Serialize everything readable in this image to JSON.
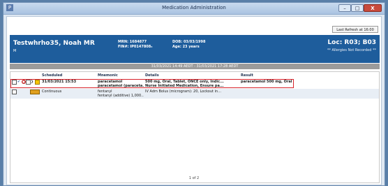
{
  "window": {
    "app_icon": "P",
    "title": "Medication Administration",
    "minimize_label": "–",
    "maximize_label": "□",
    "close_label": "X"
  },
  "toolbar": {
    "refresh_label": "Last Refresh at 16:00 AEST"
  },
  "patient": {
    "name": "Testwhrho35, Noah   MR",
    "sex": "M",
    "mrn": "MRN: 1684877",
    "fin": "FIN#: IP0147808₃",
    "dob": "DOB: 03/03/1998",
    "age": "Age: 23 years",
    "location": "Loc: R03; B03",
    "allergies": "** Allergies Not Recorded **"
  },
  "date_range": "31/03/2021 14:49 AEDT - 31/03/2021 17:28 AEDT",
  "table": {
    "columns": [
      "Scheduled",
      "Mnemonic",
      "Details",
      "Result"
    ],
    "rows": [
      {
        "scheduled": "31/03/2021 15:53",
        "mnemonic_1": "paracetamol",
        "mnemonic_2": "paracetamol (paraceta...",
        "details_1": "500 mg, Oral, Tablet, ONCE only, Indic...",
        "details_2": "Nurse Initiated Medication, Ensure pa...",
        "result": "paracetamol 500 mg, Oral"
      },
      {
        "scheduled": "Continuous",
        "mnemonic_1": "fentanyl",
        "mnemonic_2": "fentanyl (additive) 1,000...",
        "details_1": "IV Adm Bolus (microgram): 20, Lockout in...",
        "details_2": "",
        "result": ""
      }
    ]
  },
  "pager": "1 of 2",
  "icons": {
    "row1": [
      "checkbox-icon",
      "checkmark-icon",
      "stop-icon",
      "note-icon",
      "tag-icon",
      "calendar-icon"
    ],
    "row2": [
      "checkbox-icon",
      "pump-icon"
    ]
  },
  "colors": {
    "banner": "#1e5d9c",
    "highlight_border": "#d8222a",
    "date_bar": "#9b9b9b"
  }
}
